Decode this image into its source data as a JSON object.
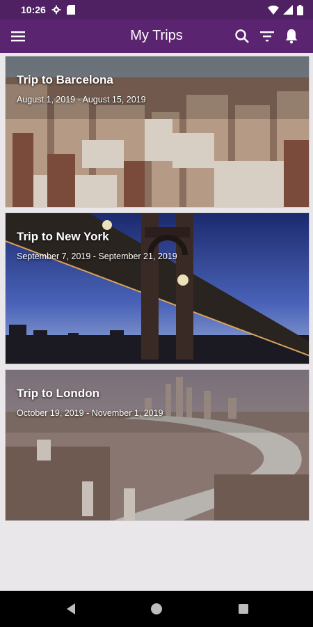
{
  "status": {
    "time": "10:26"
  },
  "header": {
    "title": "My Trips"
  },
  "icons": {
    "menu": "menu-icon",
    "search": "search-icon",
    "filter": "filter-icon",
    "notifications": "bell-icon"
  },
  "trips": [
    {
      "title": "Trip to Barcelona",
      "dates": "August 1, 2019 - August 15, 2019"
    },
    {
      "title": "Trip to New York",
      "dates": "September 7, 2019 - September 21, 2019"
    },
    {
      "title": "Trip to London",
      "dates": "October 19, 2019 - November 1, 2019"
    }
  ],
  "colors": {
    "status_bar": "#4f2163",
    "app_bar": "#5b2470",
    "background": "#e9e7ea",
    "nav_bar": "#000000"
  }
}
